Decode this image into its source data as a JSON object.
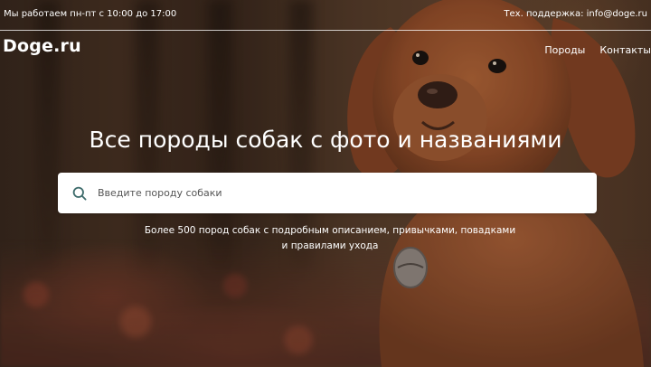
{
  "topbar": {
    "hours": "Мы работаем пн-пт с 10:00 до 17:00",
    "support": "Тех. поддержка: info@doge.ru"
  },
  "header": {
    "logo": "Doge.ru",
    "nav": [
      {
        "label": "Породы"
      },
      {
        "label": "Контакты"
      }
    ]
  },
  "hero": {
    "title": "Все породы собак с фото и названиями",
    "search": {
      "placeholder": "Введите породу собаки",
      "value": "",
      "icon": "search-icon"
    },
    "description_line1": "Более 500 пород собак с подробным описанием, привычками, повадками",
    "description_line2": "и правилами ухода"
  },
  "colors": {
    "text": "#ffffff",
    "search_bg": "#ffffff",
    "search_icon": "#3d6b6b",
    "dog_fur": "#a0552e"
  }
}
